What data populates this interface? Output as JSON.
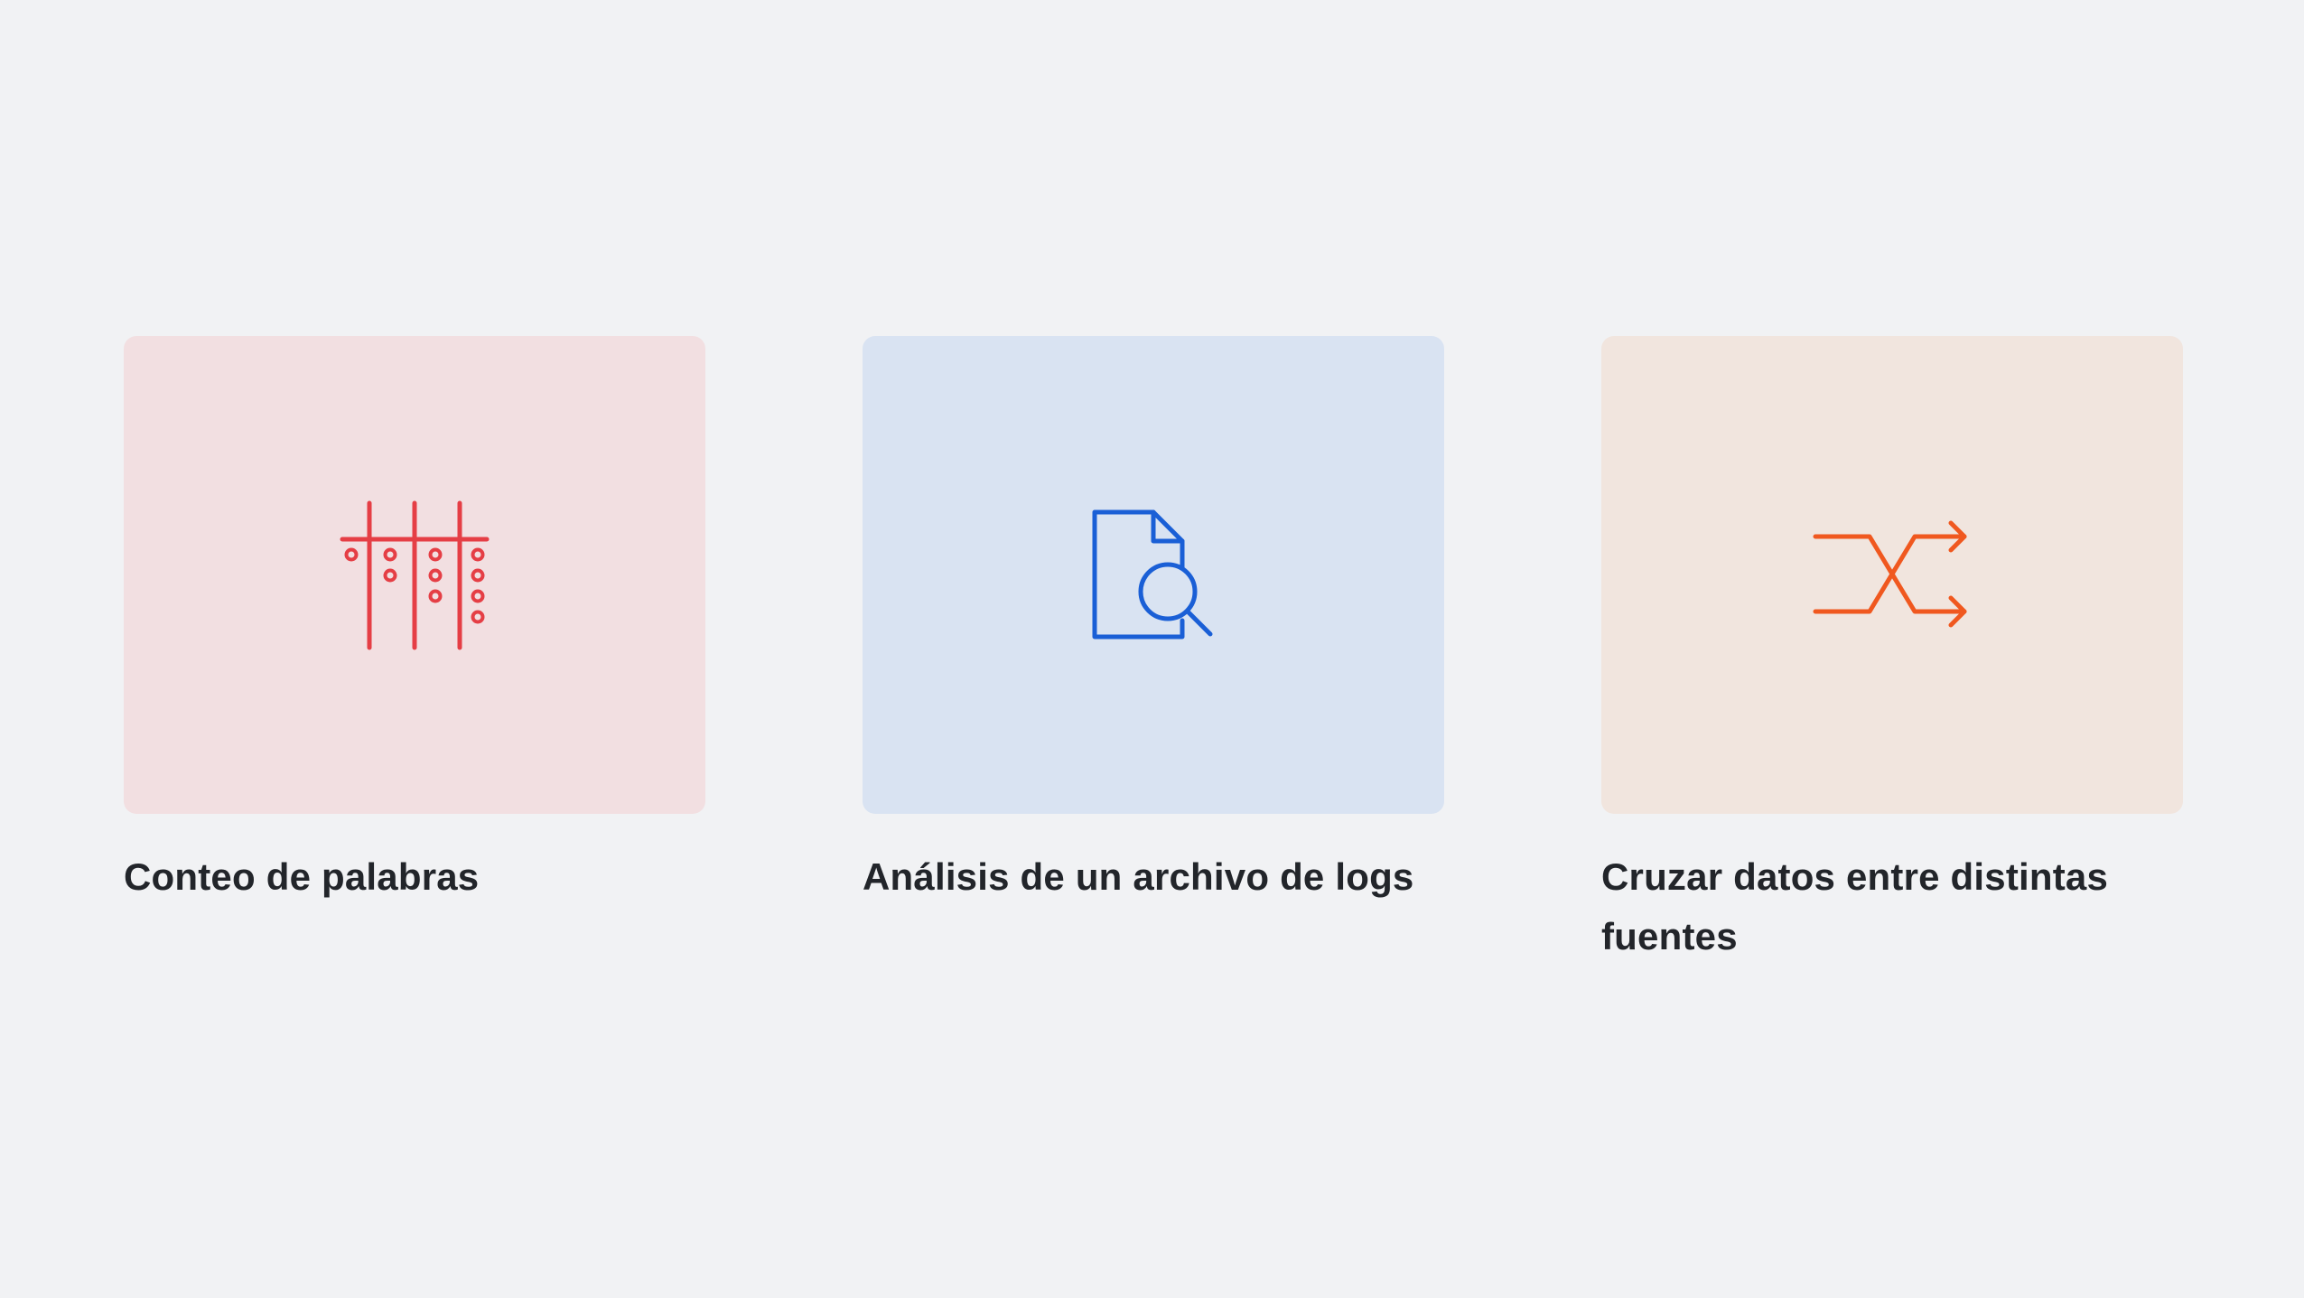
{
  "cards": [
    {
      "title": "Conteo de palabras",
      "icon": "tally-icon",
      "tile_color": "#f2dfe1",
      "icon_color": "#e53e45"
    },
    {
      "title": "Análisis de un archivo de logs",
      "icon": "document-search-icon",
      "tile_color": "#d9e3f2",
      "icon_color": "#1a5fd6"
    },
    {
      "title": "Cruzar datos entre distintas fuentes",
      "icon": "shuffle-icon",
      "tile_color": "#f1e5de",
      "icon_color": "#f0581f"
    }
  ]
}
